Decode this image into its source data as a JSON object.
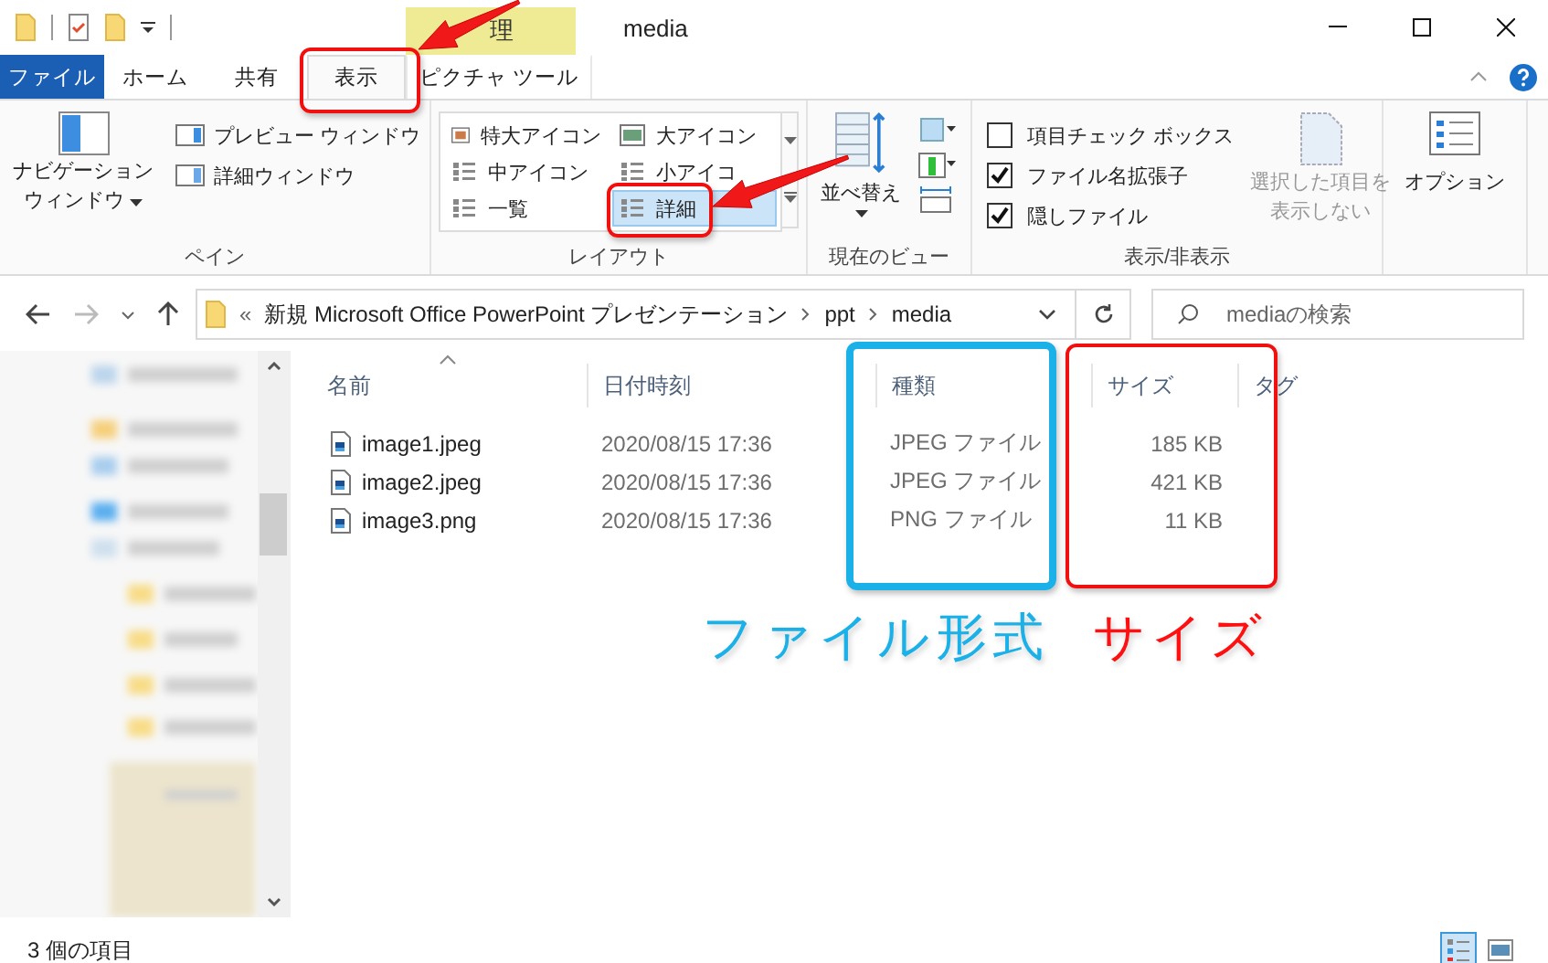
{
  "window": {
    "title": "media",
    "context_header": "理"
  },
  "tabs": [
    {
      "label": "ファイル",
      "kind": "file",
      "selected": false
    },
    {
      "label": "ホーム",
      "kind": "normal",
      "selected": false
    },
    {
      "label": "共有",
      "kind": "normal",
      "selected": false
    },
    {
      "label": "表示",
      "kind": "normal",
      "selected": true
    },
    {
      "label": "ピクチャ ツール",
      "kind": "context",
      "selected": false
    }
  ],
  "ribbon": {
    "pane": {
      "label": "ペイン",
      "navigation_pane": [
        "ナビゲーション",
        "ウィンドウ"
      ],
      "preview_pane": "プレビュー ウィンドウ",
      "details_pane": "詳細ウィンドウ"
    },
    "layout": {
      "label": "レイアウト",
      "options": [
        {
          "label": "特大アイコン",
          "selected": false
        },
        {
          "label": "大アイコン",
          "selected": false
        },
        {
          "label": "中アイコン",
          "selected": false
        },
        {
          "label": "小アイコ",
          "selected": false
        },
        {
          "label": "一覧",
          "selected": false
        },
        {
          "label": "詳細",
          "selected": true
        }
      ]
    },
    "current_view": {
      "label": "現在のビュー",
      "sort_button": "並べ替え"
    },
    "show_hide": {
      "label": "表示/非表示",
      "checkboxes": [
        {
          "label": "項目チェック ボックス",
          "checked": false
        },
        {
          "label": "ファイル名拡張子",
          "checked": true
        },
        {
          "label": "隠しファイル",
          "checked": true
        }
      ],
      "hide_selected": {
        "lines": [
          "選択した項目を",
          "表示しない"
        ],
        "disabled": true
      }
    },
    "options": {
      "label": "オプション"
    }
  },
  "address": {
    "overflow": "«",
    "segments": [
      "新規 Microsoft Office PowerPoint プレゼンテーション",
      "ppt",
      "media"
    ]
  },
  "search": {
    "placeholder": "mediaの検索"
  },
  "table": {
    "columns": [
      "名前",
      "日付時刻",
      "種類",
      "サイズ",
      "タグ"
    ],
    "rows": [
      {
        "name": "image1.jpeg",
        "date": "2020/08/15 17:36",
        "type": "JPEG ファイル",
        "size": "185 KB"
      },
      {
        "name": "image2.jpeg",
        "date": "2020/08/15 17:36",
        "type": "JPEG ファイル",
        "size": "421 KB"
      },
      {
        "name": "image3.png",
        "date": "2020/08/15 17:36",
        "type": "PNG ファイル",
        "size": "11 KB"
      }
    ]
  },
  "status_bar": {
    "count": "3 個の項目",
    "view_buttons": [
      {
        "kind": "details",
        "selected": true
      },
      {
        "kind": "large_icons",
        "selected": false
      }
    ]
  },
  "annotations": [
    {
      "label": "ファイル形式",
      "color": "#1ab0e8"
    },
    {
      "label": "サイズ",
      "color": "#ff1010"
    }
  ]
}
